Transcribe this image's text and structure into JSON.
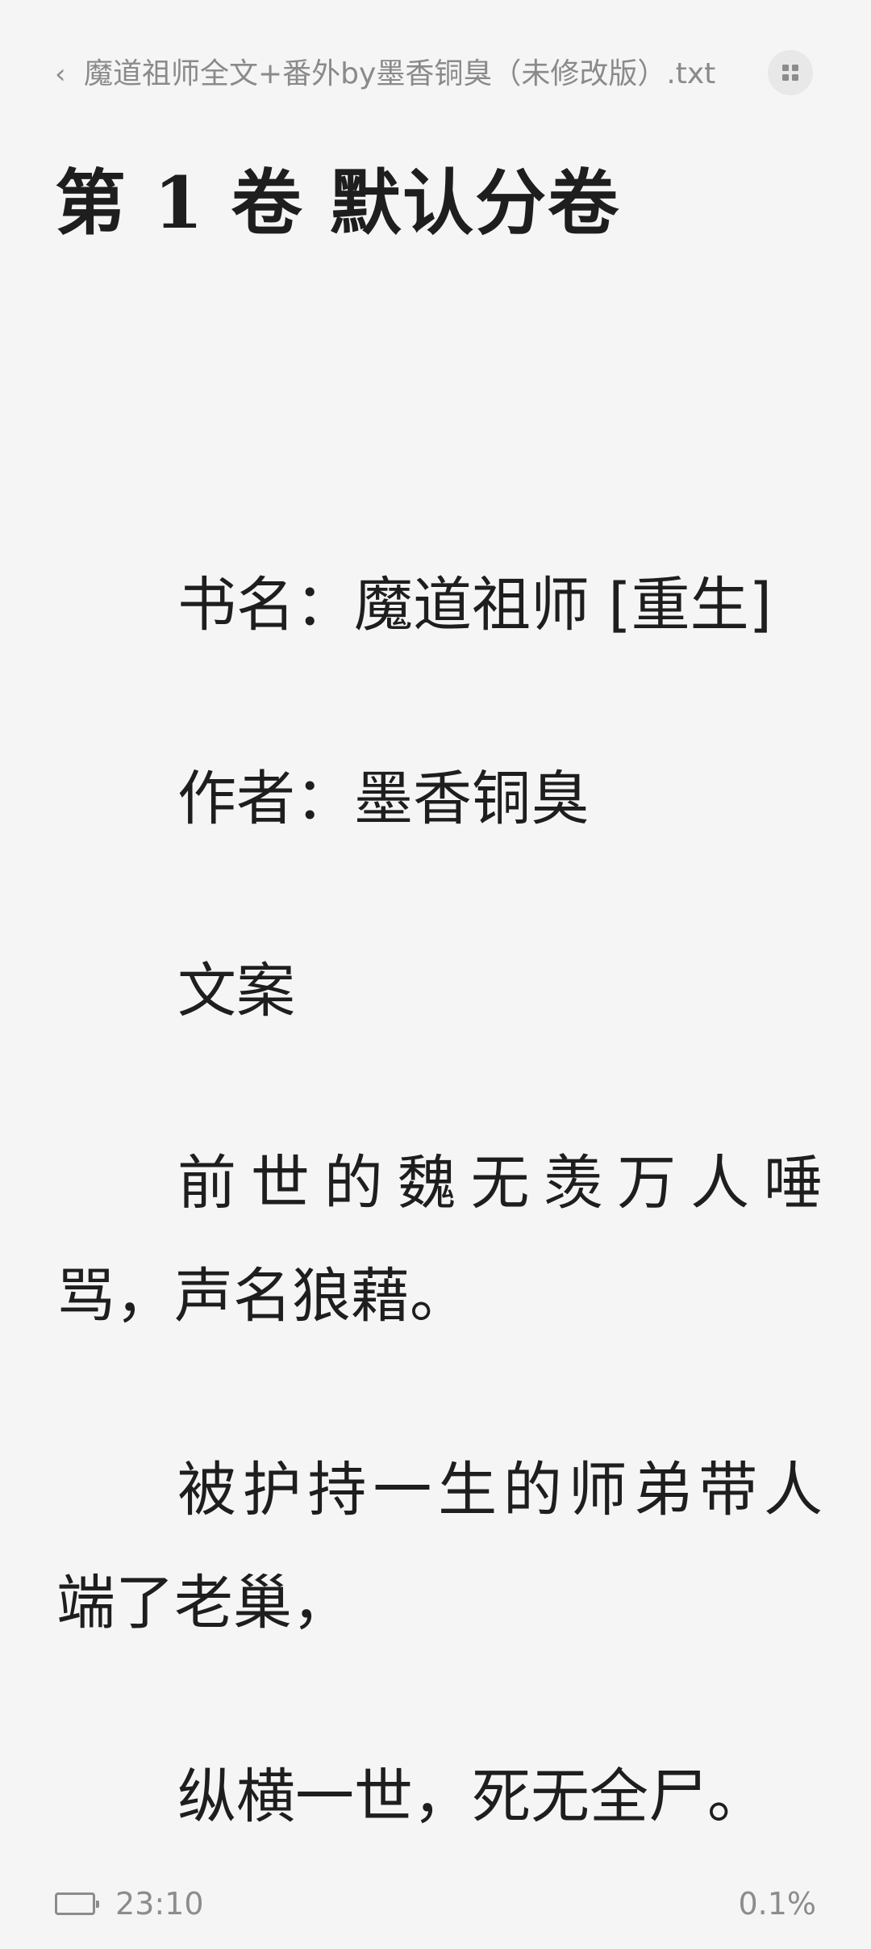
{
  "header": {
    "back_icon": "chevron-left-icon",
    "file_name": "魔道祖师全文+番外by墨香铜臭（未修改版）.txt",
    "menu_icon": "grid-icon"
  },
  "chapter": {
    "volume_title": "第 1 卷  默认分卷"
  },
  "paragraphs": [
    "书名：魔道祖师 [重生]",
    "作者：墨香铜臭",
    "文案",
    "前世的魏无羡万人唾骂，声名狼藉。",
    "被护持一生的师弟带人端了老巢，",
    "纵横一世，死无全尸。"
  ],
  "footer": {
    "battery_icon": "battery-icon",
    "time": "23:10",
    "progress": "0.1%"
  }
}
